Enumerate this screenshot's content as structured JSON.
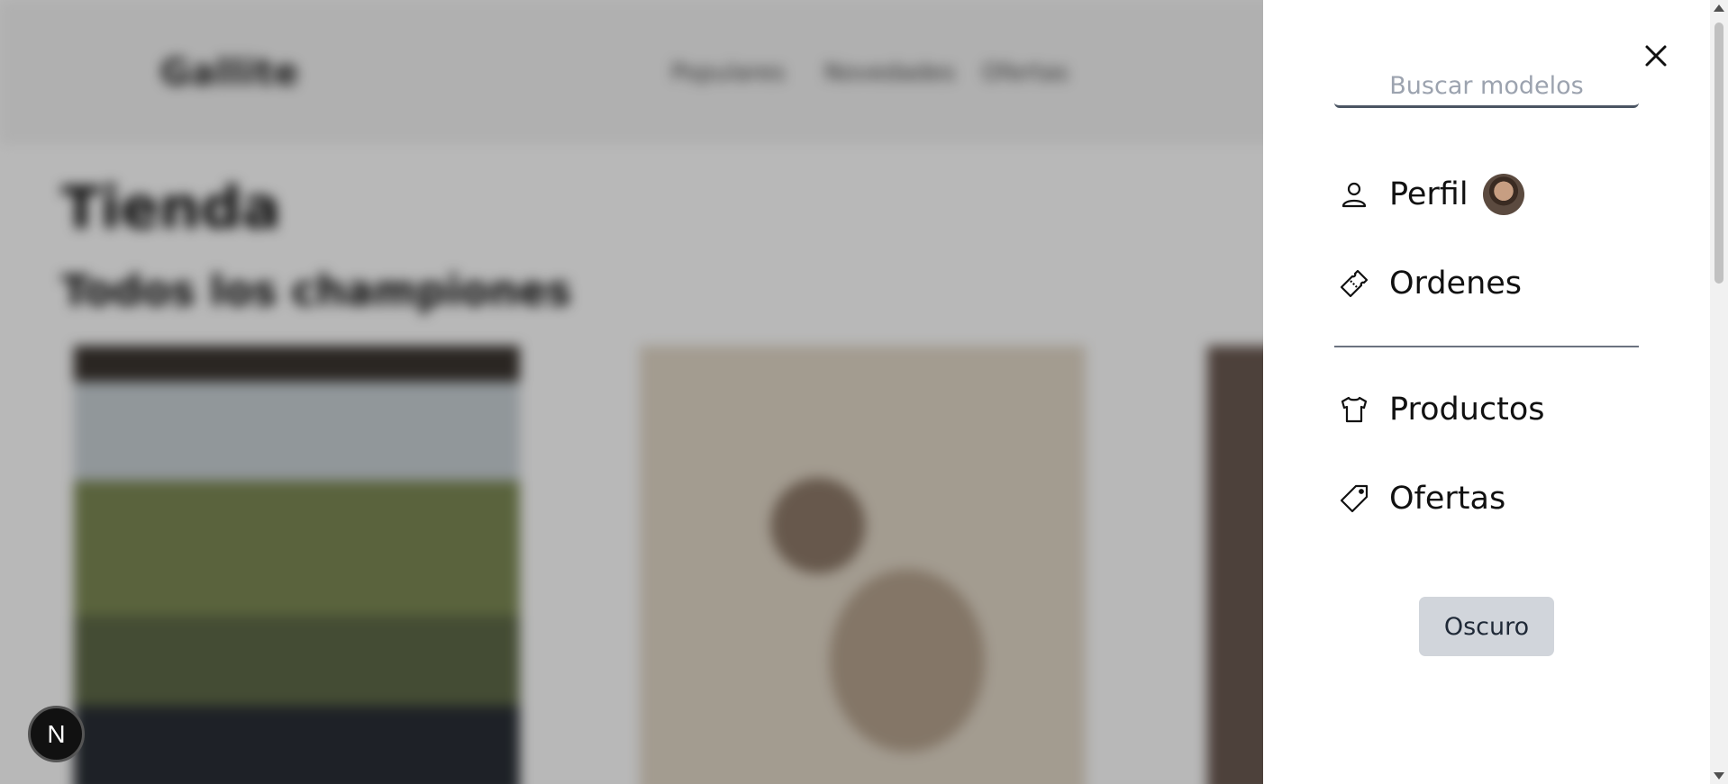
{
  "background": {
    "logo": "Gallite",
    "nav": [
      "Populares",
      "Novedades",
      "Ofertas"
    ],
    "title": "Tienda",
    "subtitle": "Todos los championes"
  },
  "fab": {
    "letter": "N"
  },
  "panel": {
    "search": {
      "placeholder": "Buscar modelos",
      "value": ""
    },
    "items": [
      {
        "label": "Perfil",
        "icon": "user-icon"
      },
      {
        "label": "Ordenes",
        "icon": "ticket-icon"
      },
      {
        "label": "Productos",
        "icon": "shirt-icon"
      },
      {
        "label": "Ofertas",
        "icon": "tag-icon"
      }
    ],
    "theme_button": "Oscuro"
  },
  "colors": {
    "panel_bg": "#ffffff",
    "overlay": "rgba(0,0,0,0.28)",
    "button_bg": "#d1d5db",
    "text": "#111111"
  }
}
